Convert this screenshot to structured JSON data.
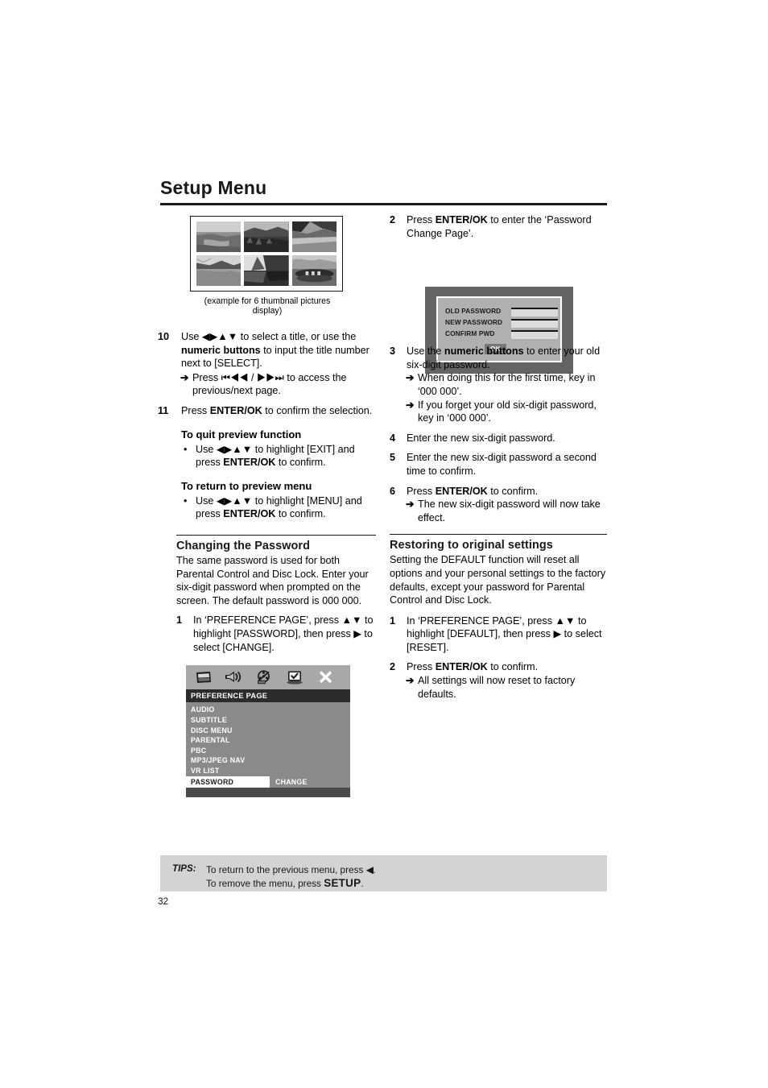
{
  "header": {
    "title": "Setup Menu"
  },
  "figure_thumbnails": {
    "caption": "(example for 6 thumbnail pictures display)",
    "count": 6
  },
  "left_column": {
    "step10": {
      "num": "10",
      "text_a": "Use ",
      "arrows_a": "◀▶▲▼",
      "text_b": " to select a title, or use the ",
      "bold_b": "numeric buttons",
      "text_c": " to input the title number next to [SELECT].",
      "sub": {
        "arrow": "➔",
        "text_a": "Press ",
        "glyph_prev": "⏮◀◀",
        "sep": " / ",
        "glyph_next": "▶▶⏭",
        "text_b": " to access the previous/next page."
      }
    },
    "step11": {
      "num": "11",
      "text_a": "Press ",
      "bold": "ENTER/OK",
      "text_b": " to confirm the selection."
    },
    "quit_preview": {
      "heading": "To quit preview function",
      "bullet": "•",
      "text_a": "Use ",
      "arrows": "◀▶▲▼",
      "text_b": " to highlight [EXIT] and press ",
      "bold": "ENTER/OK",
      "text_c": " to confirm."
    },
    "return_preview": {
      "heading": "To return to preview menu",
      "bullet": "•",
      "text_a": "Use ",
      "arrows": "◀▶▲▼",
      "text_b": " to highlight [MENU] and press ",
      "bold": "ENTER/OK",
      "text_c": " to confirm."
    },
    "changing_password": {
      "title": "Changing the Password",
      "body": "The same password is used for both Parental Control and Disc Lock. Enter your six-digit password when prompted on the screen. The default password is 000 000.",
      "step1": {
        "num": "1",
        "text_a": "In ‘PREFERENCE PAGE’, press ",
        "arrows": "▲▼",
        "text_b": " to highlight [PASSWORD], then press ",
        "arrow_right": "▶",
        "text_c": " to select [CHANGE]."
      }
    }
  },
  "osd_menu": {
    "icons": [
      "tv-screen-icon",
      "speaker-audio-icon",
      "film-reel-disabled-icon",
      "monitor-preference-icon",
      "close-x-icon"
    ],
    "title": "PREFERENCE PAGE",
    "items": [
      "AUDIO",
      "SUBTITLE",
      "DISC MENU",
      "PARENTAL",
      "PBC",
      "MP3/JPEG NAV",
      "VR LIST"
    ],
    "selected_row": {
      "label": "PASSWORD",
      "value": "CHANGE"
    }
  },
  "right_column": {
    "step2": {
      "num": "2",
      "text_a": "Press ",
      "bold": "ENTER/OK",
      "text_b": " to enter the ‘Password Change Page’."
    },
    "password_dialog": {
      "rows": [
        {
          "label": "OLD PASSWORD",
          "value": ""
        },
        {
          "label": "NEW PASSWORD",
          "value": ""
        },
        {
          "label": "CONFIRM PWD",
          "value": ""
        }
      ],
      "ok_label": "OK"
    },
    "step3": {
      "num": "3",
      "text_a": "Use the ",
      "bold": "numeric buttons",
      "text_b": " to enter your old six-digit password.",
      "sub1": {
        "arrow": "➔",
        "text": "When doing this for the first time, key in ‘000 000’."
      },
      "sub2": {
        "arrow": "➔",
        "text": "If you forget your old six-digit password, key in ‘000 000’."
      }
    },
    "step4": {
      "num": "4",
      "text": "Enter the new six-digit password."
    },
    "step5": {
      "num": "5",
      "text": "Enter the new six-digit password a second time to confirm."
    },
    "step6": {
      "num": "6",
      "text_a": "Press ",
      "bold": "ENTER/OK",
      "text_b": " to confirm.",
      "sub": {
        "arrow": "➔",
        "text": "The new six-digit password will now take effect."
      }
    },
    "restoring": {
      "title": "Restoring to original settings",
      "body": "Setting the DEFAULT function will reset all options and your personal settings to the factory defaults, except your password for Parental Control and Disc Lock.",
      "step1": {
        "num": "1",
        "text_a": "In ‘PREFERENCE PAGE’, press ",
        "arrows": "▲▼",
        "text_b": " to highlight [DEFAULT], then press ",
        "arrow_right": "▶",
        "text_c": " to select [RESET]."
      },
      "step2": {
        "num": "2",
        "text_a": "Press ",
        "bold": "ENTER/OK",
        "text_b": " to confirm.",
        "sub": {
          "arrow": "➔",
          "text": "All settings will now reset to factory defaults."
        }
      }
    }
  },
  "tips": {
    "label": "TIPS:",
    "line1_a": "To return to the previous menu, press ",
    "line1_arrow": "◀",
    "line1_b": ".",
    "line2_a": "To remove the menu, press ",
    "line2_bold": "SETUP",
    "line2_b": "."
  },
  "page_number": "32",
  "colors": {
    "tips_background": "#d3d3d3",
    "osd_frame": "#4a4a4a",
    "osd_iconbar": "#a8a8a8",
    "osd_titlebar": "#2c2c2c",
    "osd_list": "#8a8a8a",
    "dialog_frame": "#646464",
    "dialog_panel": "#b0b0b0",
    "text": "#16181a"
  }
}
